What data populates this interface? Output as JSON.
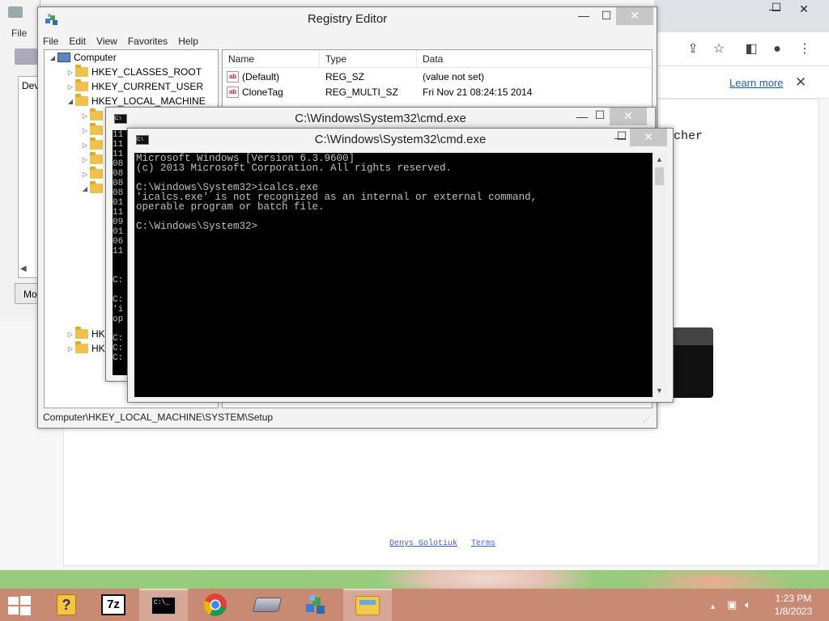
{
  "browser": {
    "info_bar": {
      "learn_more": "Learn more",
      "close": "✕"
    },
    "page_partial_text": "cher",
    "footer_links": [
      "Denys Golotiuk",
      "Terms"
    ]
  },
  "back_window": {
    "menu_file": "File",
    "list_partial": "Dev",
    "button_partial": "Mo"
  },
  "regedit": {
    "title": "Registry Editor",
    "menu": [
      "File",
      "Edit",
      "View",
      "Favorites",
      "Help"
    ],
    "tree": [
      {
        "label": "Computer",
        "indent": 0,
        "expander": "◢"
      },
      {
        "label": "HKEY_CLASSES_ROOT",
        "indent": 1,
        "expander": "▷"
      },
      {
        "label": "HKEY_CURRENT_USER",
        "indent": 1,
        "expander": "▷"
      },
      {
        "label": "HKEY_LOCAL_MACHINE",
        "indent": 1,
        "expander": "◢"
      }
    ],
    "tree_partial": [
      "HK",
      "HK"
    ],
    "columns": [
      "Name",
      "Type",
      "Data"
    ],
    "values": [
      {
        "name": "(Default)",
        "type": "REG_SZ",
        "data": "(value not set)"
      },
      {
        "name": "CloneTag",
        "type": "REG_MULTI_SZ",
        "data": "Fri Nov 21 08:24:15 2014"
      }
    ],
    "status_path": "Computer\\HKEY_LOCAL_MACHINE\\SYSTEM\\Setup"
  },
  "cmd_back": {
    "title": "C:\\Windows\\System32\\cmd.exe",
    "lines": [
      "11",
      "11",
      "11",
      "08",
      "08",
      "08",
      "08",
      "01",
      "11",
      "09",
      "01",
      "06",
      "11",
      "",
      "",
      "C:",
      "",
      "C:",
      "'i",
      "op",
      "",
      "C:",
      "C:",
      "C:"
    ]
  },
  "cmd_front": {
    "title": "C:\\Windows\\System32\\cmd.exe",
    "lines": [
      "Microsoft Windows [Version 6.3.9600]",
      "(c) 2013 Microsoft Corporation. All rights reserved.",
      "",
      "C:\\Windows\\System32>icalcs.exe",
      "'icalcs.exe' is not recognized as an internal or external command,",
      "operable program or batch file.",
      "",
      "C:\\Windows\\System32>"
    ]
  },
  "window_buttons": {
    "minimize": "—",
    "maximize": "☐",
    "close": "✕"
  },
  "taskbar": {
    "items": [
      "help-icon",
      "7zip-icon",
      "cmd-icon",
      "chrome-icon",
      "drive-icon",
      "regedit-icon",
      "file-explorer-icon"
    ],
    "seven_zip_label": "7z",
    "cmd_label": "C:\\_",
    "tray_up": "▲",
    "time": "1:23 PM",
    "date": "1/8/2023"
  },
  "colors": {
    "taskbar": "#c98a73",
    "console_bg": "#000000",
    "console_text": "#c0c0c0",
    "link": "#1a5fb4"
  }
}
